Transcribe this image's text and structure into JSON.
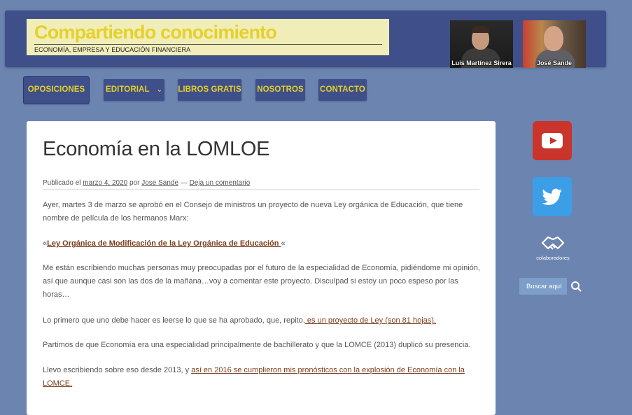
{
  "header": {
    "site_title": "Compartiendo conocimiento",
    "tagline": "ECONOMÍA, EMPRESA Y EDUCACIÓN FINANCIERA",
    "authors": [
      {
        "name": "Luis Martínez Sirera"
      },
      {
        "name": "José Sande"
      }
    ]
  },
  "nav": {
    "items": [
      {
        "label": "OPOSICIONES"
      },
      {
        "label": "EDITORIAL"
      },
      {
        "label": "LIBROS GRATIS"
      },
      {
        "label": "NOSOTROS"
      },
      {
        "label": "CONTACTO"
      }
    ]
  },
  "post": {
    "title": "Economía en la LOMLOE",
    "meta": {
      "published_prefix": "Publicado el",
      "date": "marzo 4, 2020",
      "by": "por",
      "author": "Jose Sande",
      "separator": "—",
      "comment_link": "Deja un comentario"
    },
    "p1": "Ayer, martes 3 de marzo se aprobó en el Consejo de ministros un proyecto de nueva Ley orgánica de Educación, que tiene nombre de película de los hermanos Marx:",
    "p2_open": "«",
    "p2_link": "Ley Orgánica de Modificación de la Ley Orgánica de Educación ",
    "p2_close": "«",
    "p3": "Me están escribiendo muchas personas muy preocupadas por el futuro de la especialidad de Economía, pidiéndome mi opinión, así que aunque casi son las dos de la mañana…voy a comentar este proyecto. Disculpad si estoy un poco espeso por las horas…",
    "p4_text": "Lo primero que uno debe hacer es leerse lo que se ha aprobado, que, repito,",
    "p4_link": " es un proyecto de Ley (son 81 hojas).",
    "p5": "Partimos de que Economía era una especialidad principalmente de bachillerato y que la LOMCE (2013) duplicó su presencia.",
    "p6_text": "Llevo escribiendo sobre eso desde 2013, y ",
    "p6_link": "así en 2016 se cumplieron mis pronósticos con la explosión de Economía con la LOMCE."
  },
  "sidebar": {
    "youtube_icon": "youtube-icon",
    "twitter_icon": "twitter-icon",
    "collab_label": "colaboradores",
    "search_placeholder": "Buscar aquí"
  },
  "colors": {
    "background": "#6b85b0",
    "header": "#3f4f8a",
    "accent_yellow": "#e6d02a",
    "link": "#7a3d1d"
  }
}
